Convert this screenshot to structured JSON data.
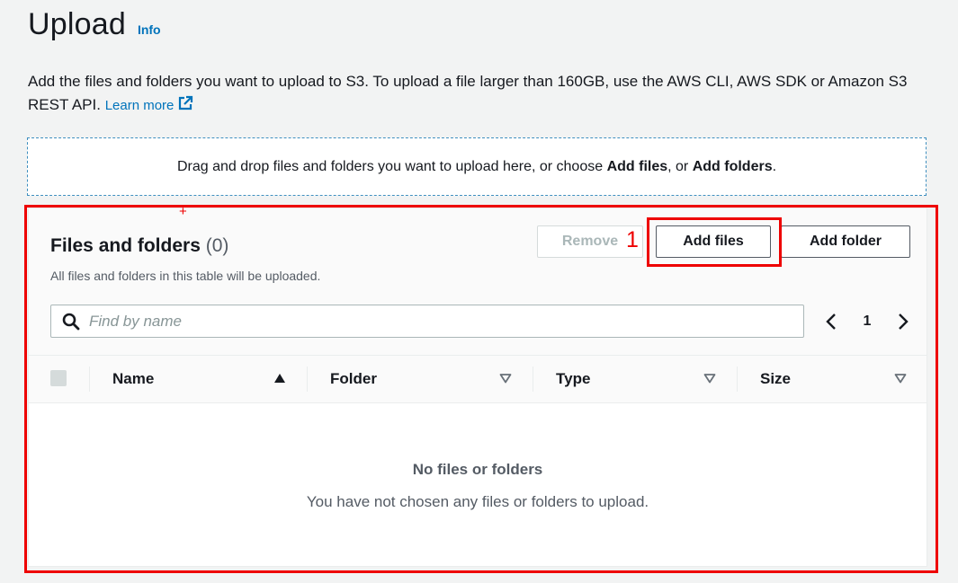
{
  "header": {
    "title": "Upload",
    "info_label": "Info"
  },
  "description": {
    "text": "Add the files and folders you want to upload to S3. To upload a file larger than 160GB, use the AWS CLI, AWS SDK or Amazon S3 REST API.",
    "learn_more": "Learn more"
  },
  "dropzone": {
    "prefix": "Drag and drop files and folders you want to upload here, or choose ",
    "add_files": "Add files",
    "middle": ", or ",
    "add_folders": "Add folders",
    "suffix": "."
  },
  "panel": {
    "title": "Files and folders",
    "count": "(0)",
    "subtitle": "All files and folders in this table will be uploaded.",
    "buttons": {
      "remove": "Remove",
      "add_files": "Add files",
      "add_folder": "Add folder"
    },
    "search": {
      "placeholder": "Find by name",
      "value": ""
    },
    "pagination": {
      "current_page": "1"
    },
    "table": {
      "columns": [
        {
          "label": "Name",
          "sort": "ascending"
        },
        {
          "label": "Folder",
          "sort": "none"
        },
        {
          "label": "Type",
          "sort": "none"
        },
        {
          "label": "Size",
          "sort": "none"
        }
      ],
      "empty_title": "No files or folders",
      "empty_description": "You have not chosen any files or folders to upload."
    }
  },
  "annotations": {
    "marker_number": "1",
    "color": "#ee0000"
  },
  "colors": {
    "link": "#0073bb",
    "dropzone_border": "#3f8fbf",
    "background": "#f2f3f3"
  }
}
